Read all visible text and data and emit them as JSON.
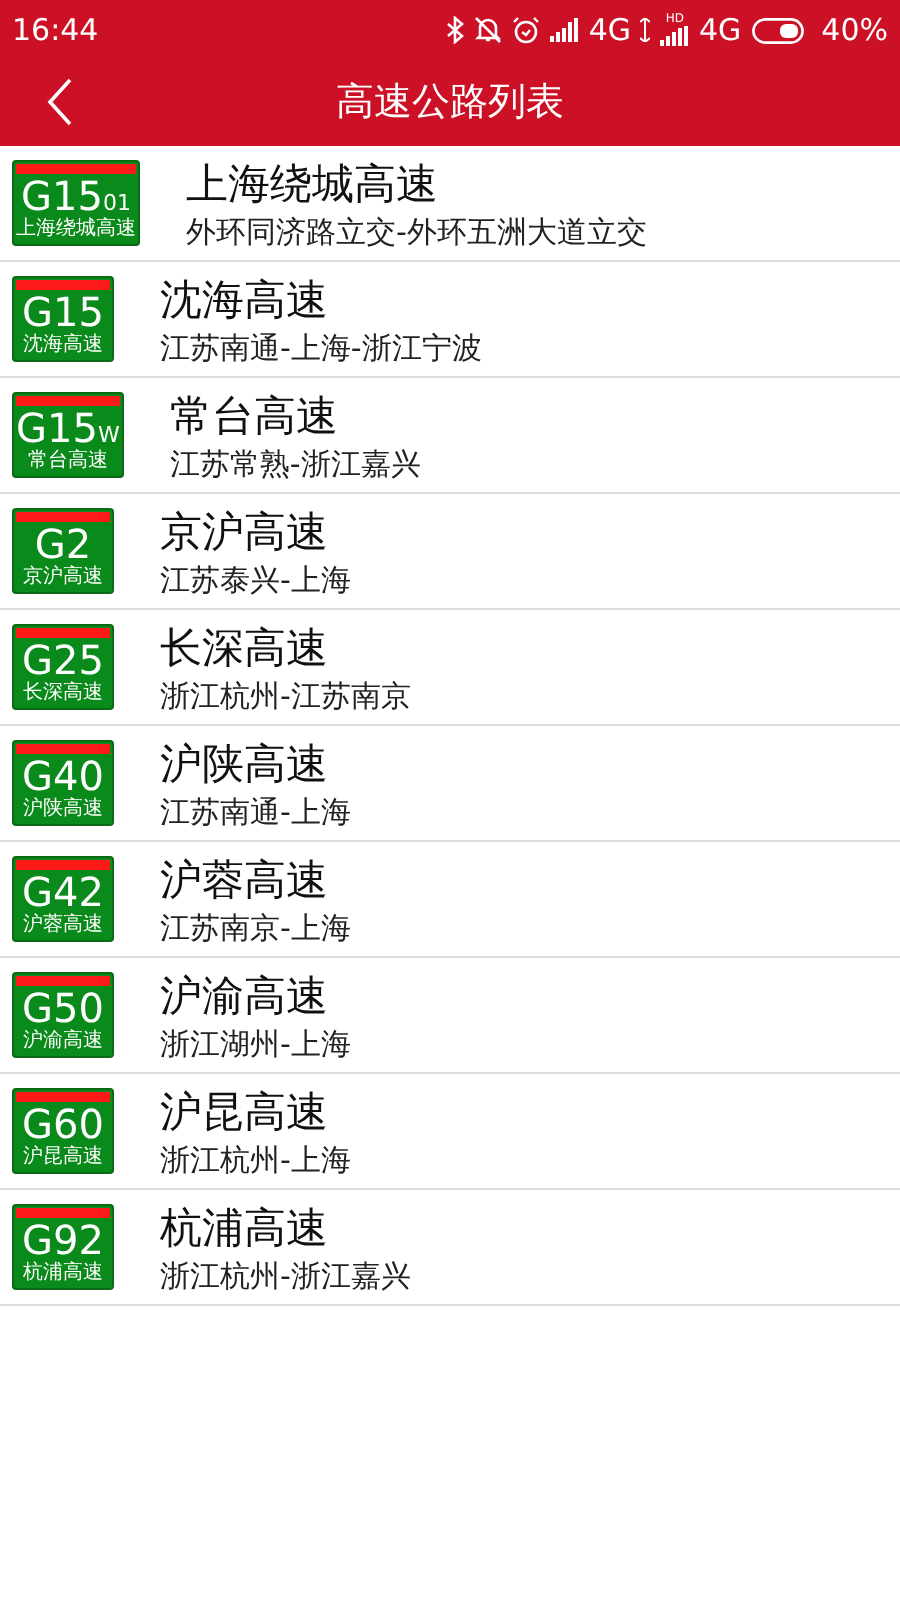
{
  "status_bar": {
    "time": "16:44",
    "network_1": "4G",
    "hd_label": "HD",
    "network_2": "4G",
    "battery": "40%"
  },
  "title_bar": {
    "title": "高速公路列表"
  },
  "highways": [
    {
      "code": "G15$_{01}$",
      "badge_name": "上海绕城高速",
      "name": "上海绕城高速",
      "route": "外环同济路立交-外环五洲大道立交"
    },
    {
      "code": "G15",
      "badge_name": "沈海高速",
      "name": "沈海高速",
      "route": "江苏南通-上海-浙江宁波"
    },
    {
      "code": "G15$_{W}$",
      "badge_name": "常台高速",
      "name": "常台高速",
      "route": "江苏常熟-浙江嘉兴"
    },
    {
      "code": "G2",
      "badge_name": "京沪高速",
      "name": "京沪高速",
      "route": "江苏泰兴-上海"
    },
    {
      "code": "G25",
      "badge_name": "长深高速",
      "name": "长深高速",
      "route": "浙江杭州-江苏南京"
    },
    {
      "code": "G40",
      "badge_name": "沪陕高速",
      "name": "沪陕高速",
      "route": "江苏南通-上海"
    },
    {
      "code": "G42",
      "badge_name": "沪蓉高速",
      "name": "沪蓉高速",
      "route": "江苏南京-上海"
    },
    {
      "code": "G50",
      "badge_name": "沪渝高速",
      "name": "沪渝高速",
      "route": "浙江湖州-上海"
    },
    {
      "code": "G60",
      "badge_name": "沪昆高速",
      "name": "沪昆高速",
      "route": "浙江杭州-上海"
    },
    {
      "code": "G92",
      "badge_name": "杭浦高速",
      "name": "杭浦高速",
      "route": "浙江杭州-浙江嘉兴"
    }
  ]
}
